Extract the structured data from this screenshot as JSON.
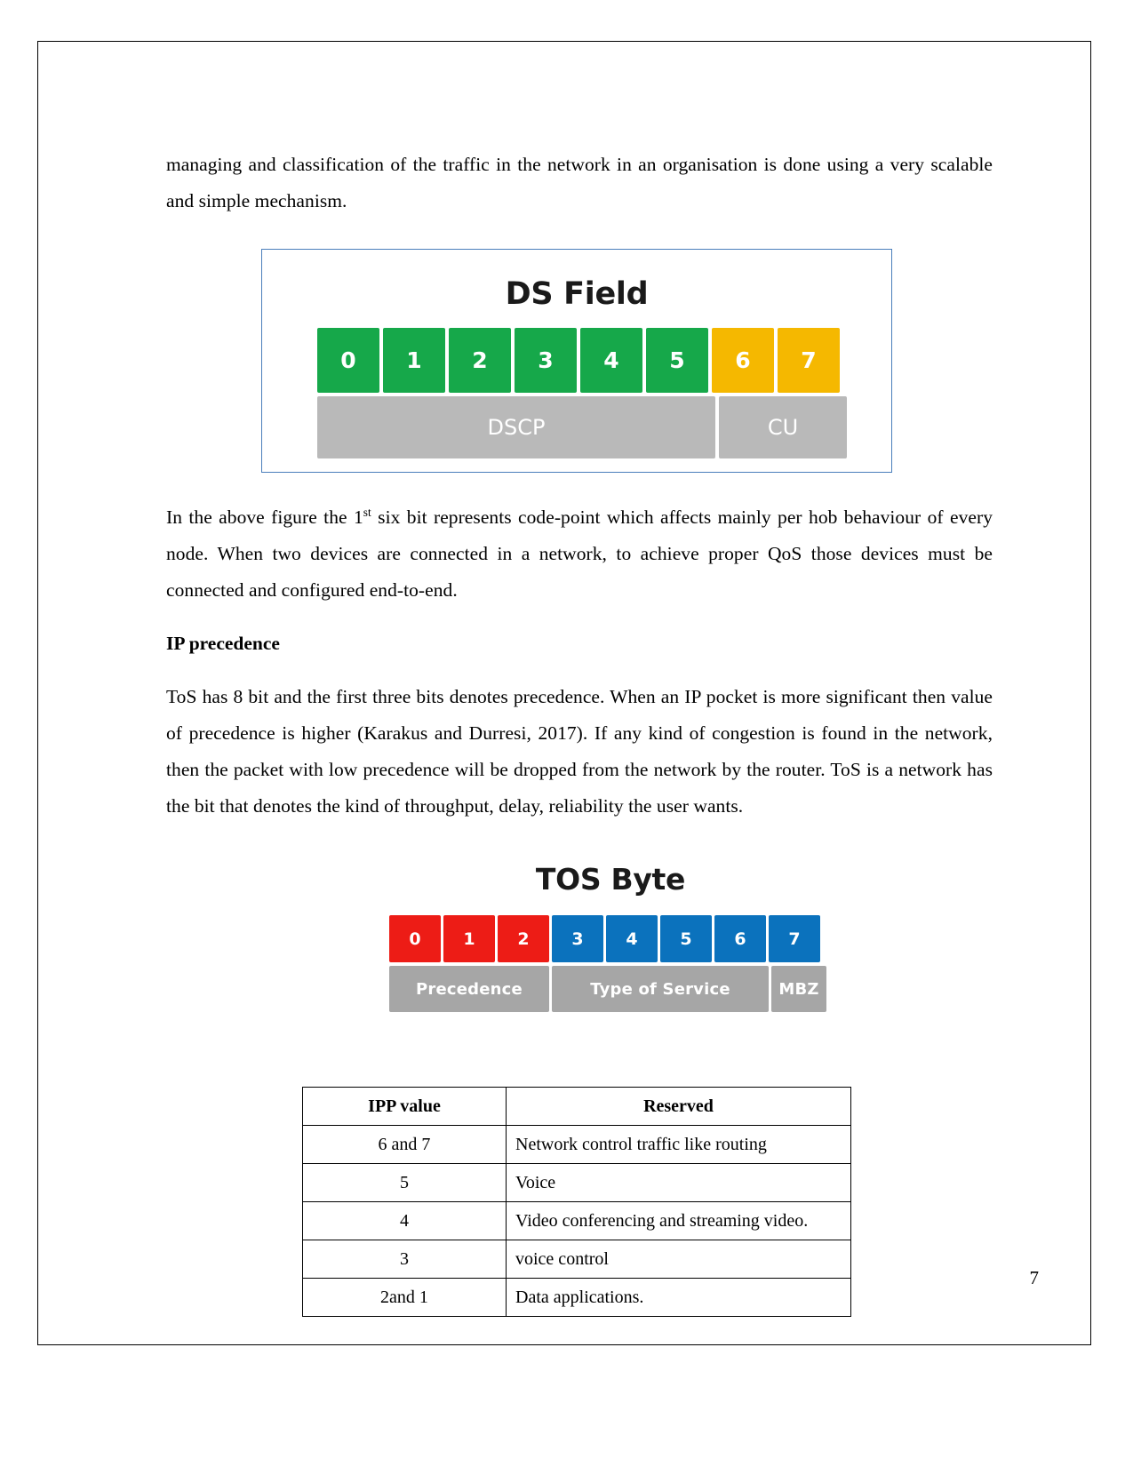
{
  "document": {
    "page_number": "7",
    "paragraphs": {
      "intro": "managing and classification of the traffic in the network in an organisation is done using a very scalable and simple mechanism.",
      "after_ds_figure_pre": "In the above figure the 1",
      "after_ds_figure_sup": "st",
      "after_ds_figure_post": " six bit represents code-point which affects mainly per hob behaviour of every node. When two devices are connected in a network, to achieve proper QoS those devices must be connected and configured end-to-end.",
      "ip_precedence_heading": "IP precedence",
      "tos_paragraph": "ToS has 8 bit and the first three bits denotes precedence. When an IP pocket is more significant then value of precedence is higher (Karakus and Durresi, 2017). If any kind of congestion is found in the network, then the packet with low precedence will be dropped from the network by the router. ToS is a network has the bit that denotes the kind of throughput, delay, reliability the user wants."
    }
  },
  "ds_field_figure": {
    "title": "DS Field",
    "bits": [
      {
        "label": "0",
        "color": "green"
      },
      {
        "label": "1",
        "color": "green"
      },
      {
        "label": "2",
        "color": "green"
      },
      {
        "label": "3",
        "color": "green"
      },
      {
        "label": "4",
        "color": "green"
      },
      {
        "label": "5",
        "color": "green"
      },
      {
        "label": "6",
        "color": "amber"
      },
      {
        "label": "7",
        "color": "amber"
      }
    ],
    "field_labels": [
      {
        "label": "DSCP",
        "span": "0-5"
      },
      {
        "label": "CU",
        "span": "6-7"
      }
    ],
    "colors": {
      "green": "#16a84a",
      "amber": "#f5b800",
      "gray": "#b9b9b9",
      "border": "#4a7ebb"
    }
  },
  "tos_byte_figure": {
    "title": "TOS Byte",
    "bits": [
      {
        "label": "0",
        "color": "red"
      },
      {
        "label": "1",
        "color": "red"
      },
      {
        "label": "2",
        "color": "red"
      },
      {
        "label": "3",
        "color": "blue"
      },
      {
        "label": "4",
        "color": "blue"
      },
      {
        "label": "5",
        "color": "blue"
      },
      {
        "label": "6",
        "color": "blue"
      },
      {
        "label": "7",
        "color": "blue"
      }
    ],
    "field_labels": [
      {
        "label": "Precedence",
        "span": "0-2"
      },
      {
        "label": "Type of Service",
        "span": "3-6"
      },
      {
        "label": "MBZ",
        "span": "7"
      }
    ],
    "colors": {
      "red": "#ed1c16",
      "blue": "#0b72bd",
      "gray": "#a6a6a6"
    }
  },
  "ipp_table": {
    "headers": [
      "IPP  value",
      "Reserved"
    ],
    "rows": [
      [
        "6 and 7",
        "Network control traffic like routing"
      ],
      [
        "5",
        "Voice"
      ],
      [
        "4",
        "Video conferencing and streaming video."
      ],
      [
        "3",
        "voice control"
      ],
      [
        "2and 1",
        "Data applications."
      ]
    ]
  }
}
